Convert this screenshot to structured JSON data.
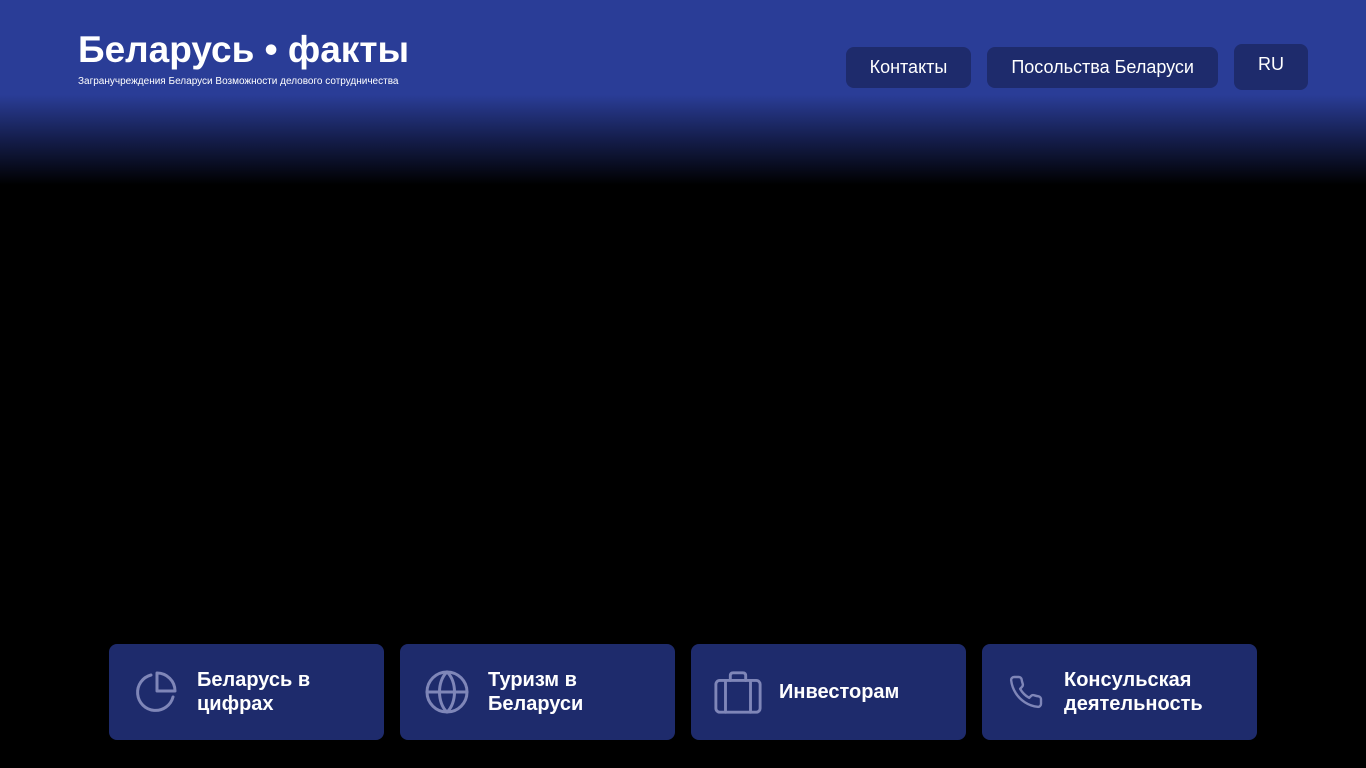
{
  "header": {
    "title": "Беларусь • факты",
    "subtitle": "Загранучреждения Беларуси Возможности делового сотрудничества"
  },
  "nav": {
    "contacts_label": "Контакты",
    "embassies_label": "Посольства Беларуси",
    "language_label": "RU"
  },
  "cards": [
    {
      "label": "Беларусь в цифрах",
      "icon": "pie-chart-icon"
    },
    {
      "label": "Туризм в Беларуси",
      "icon": "globe-icon"
    },
    {
      "label": "Инвесторам",
      "icon": "briefcase-icon"
    },
    {
      "label": "Консульская деятельность",
      "icon": "phone-icon"
    }
  ],
  "colors": {
    "header_blue": "#2a3d97",
    "button_blue": "#1e2b6c",
    "icon_color": "#7f86b8",
    "background": "#000000"
  }
}
